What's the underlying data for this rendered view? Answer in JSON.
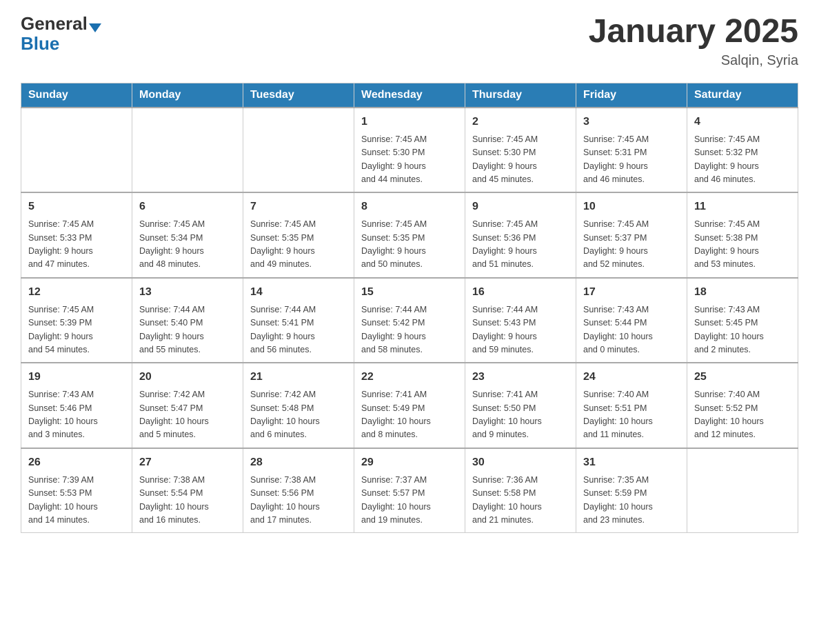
{
  "header": {
    "logo_general": "General",
    "logo_blue": "Blue",
    "title": "January 2025",
    "subtitle": "Salqin, Syria"
  },
  "days_of_week": [
    "Sunday",
    "Monday",
    "Tuesday",
    "Wednesday",
    "Thursday",
    "Friday",
    "Saturday"
  ],
  "weeks": [
    [
      {
        "day": "",
        "info": ""
      },
      {
        "day": "",
        "info": ""
      },
      {
        "day": "",
        "info": ""
      },
      {
        "day": "1",
        "info": "Sunrise: 7:45 AM\nSunset: 5:30 PM\nDaylight: 9 hours\nand 44 minutes."
      },
      {
        "day": "2",
        "info": "Sunrise: 7:45 AM\nSunset: 5:30 PM\nDaylight: 9 hours\nand 45 minutes."
      },
      {
        "day": "3",
        "info": "Sunrise: 7:45 AM\nSunset: 5:31 PM\nDaylight: 9 hours\nand 46 minutes."
      },
      {
        "day": "4",
        "info": "Sunrise: 7:45 AM\nSunset: 5:32 PM\nDaylight: 9 hours\nand 46 minutes."
      }
    ],
    [
      {
        "day": "5",
        "info": "Sunrise: 7:45 AM\nSunset: 5:33 PM\nDaylight: 9 hours\nand 47 minutes."
      },
      {
        "day": "6",
        "info": "Sunrise: 7:45 AM\nSunset: 5:34 PM\nDaylight: 9 hours\nand 48 minutes."
      },
      {
        "day": "7",
        "info": "Sunrise: 7:45 AM\nSunset: 5:35 PM\nDaylight: 9 hours\nand 49 minutes."
      },
      {
        "day": "8",
        "info": "Sunrise: 7:45 AM\nSunset: 5:35 PM\nDaylight: 9 hours\nand 50 minutes."
      },
      {
        "day": "9",
        "info": "Sunrise: 7:45 AM\nSunset: 5:36 PM\nDaylight: 9 hours\nand 51 minutes."
      },
      {
        "day": "10",
        "info": "Sunrise: 7:45 AM\nSunset: 5:37 PM\nDaylight: 9 hours\nand 52 minutes."
      },
      {
        "day": "11",
        "info": "Sunrise: 7:45 AM\nSunset: 5:38 PM\nDaylight: 9 hours\nand 53 minutes."
      }
    ],
    [
      {
        "day": "12",
        "info": "Sunrise: 7:45 AM\nSunset: 5:39 PM\nDaylight: 9 hours\nand 54 minutes."
      },
      {
        "day": "13",
        "info": "Sunrise: 7:44 AM\nSunset: 5:40 PM\nDaylight: 9 hours\nand 55 minutes."
      },
      {
        "day": "14",
        "info": "Sunrise: 7:44 AM\nSunset: 5:41 PM\nDaylight: 9 hours\nand 56 minutes."
      },
      {
        "day": "15",
        "info": "Sunrise: 7:44 AM\nSunset: 5:42 PM\nDaylight: 9 hours\nand 58 minutes."
      },
      {
        "day": "16",
        "info": "Sunrise: 7:44 AM\nSunset: 5:43 PM\nDaylight: 9 hours\nand 59 minutes."
      },
      {
        "day": "17",
        "info": "Sunrise: 7:43 AM\nSunset: 5:44 PM\nDaylight: 10 hours\nand 0 minutes."
      },
      {
        "day": "18",
        "info": "Sunrise: 7:43 AM\nSunset: 5:45 PM\nDaylight: 10 hours\nand 2 minutes."
      }
    ],
    [
      {
        "day": "19",
        "info": "Sunrise: 7:43 AM\nSunset: 5:46 PM\nDaylight: 10 hours\nand 3 minutes."
      },
      {
        "day": "20",
        "info": "Sunrise: 7:42 AM\nSunset: 5:47 PM\nDaylight: 10 hours\nand 5 minutes."
      },
      {
        "day": "21",
        "info": "Sunrise: 7:42 AM\nSunset: 5:48 PM\nDaylight: 10 hours\nand 6 minutes."
      },
      {
        "day": "22",
        "info": "Sunrise: 7:41 AM\nSunset: 5:49 PM\nDaylight: 10 hours\nand 8 minutes."
      },
      {
        "day": "23",
        "info": "Sunrise: 7:41 AM\nSunset: 5:50 PM\nDaylight: 10 hours\nand 9 minutes."
      },
      {
        "day": "24",
        "info": "Sunrise: 7:40 AM\nSunset: 5:51 PM\nDaylight: 10 hours\nand 11 minutes."
      },
      {
        "day": "25",
        "info": "Sunrise: 7:40 AM\nSunset: 5:52 PM\nDaylight: 10 hours\nand 12 minutes."
      }
    ],
    [
      {
        "day": "26",
        "info": "Sunrise: 7:39 AM\nSunset: 5:53 PM\nDaylight: 10 hours\nand 14 minutes."
      },
      {
        "day": "27",
        "info": "Sunrise: 7:38 AM\nSunset: 5:54 PM\nDaylight: 10 hours\nand 16 minutes."
      },
      {
        "day": "28",
        "info": "Sunrise: 7:38 AM\nSunset: 5:56 PM\nDaylight: 10 hours\nand 17 minutes."
      },
      {
        "day": "29",
        "info": "Sunrise: 7:37 AM\nSunset: 5:57 PM\nDaylight: 10 hours\nand 19 minutes."
      },
      {
        "day": "30",
        "info": "Sunrise: 7:36 AM\nSunset: 5:58 PM\nDaylight: 10 hours\nand 21 minutes."
      },
      {
        "day": "31",
        "info": "Sunrise: 7:35 AM\nSunset: 5:59 PM\nDaylight: 10 hours\nand 23 minutes."
      },
      {
        "day": "",
        "info": ""
      }
    ]
  ]
}
